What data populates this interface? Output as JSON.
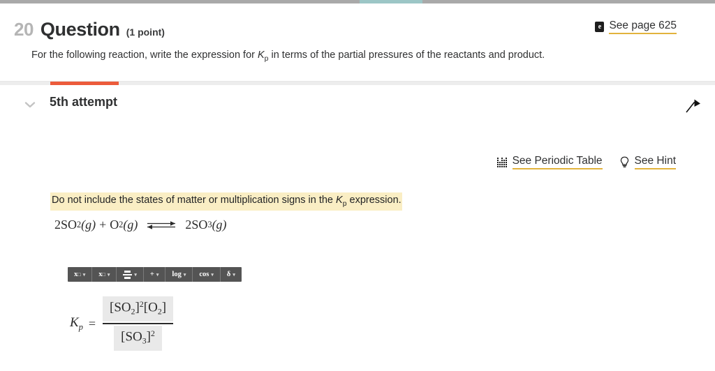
{
  "progress": {
    "completed_segment_label": "current-question-segment",
    "track_color": "#a9a9a9",
    "segment_color": "#9cc6c6"
  },
  "question": {
    "number": "20",
    "title": "Question",
    "points": "(1 point)",
    "prompt_part1": "For the following reaction, write the expression for ",
    "prompt_k": "K",
    "prompt_k_sub": "p",
    "prompt_part2": " in terms of the partial pressures of the reactants and product."
  },
  "ebook": {
    "icon_glyph": "e",
    "label": "See page 625"
  },
  "attempt": {
    "label": "5th attempt",
    "tab_indicator_color": "#ec5b3b",
    "chevron_icon": "chevron-down-icon",
    "flag_icon": "flag-icon"
  },
  "helpers": [
    {
      "icon": "periodic-table-icon",
      "label": "See Periodic Table"
    },
    {
      "icon": "lightbulb-icon",
      "label": "See Hint"
    }
  ],
  "instruction": {
    "part1": "Do not include the states of matter or multiplication signs in the ",
    "k": "K",
    "k_sub": "p",
    "part2": " expression.",
    "highlight_color": "#faeec4"
  },
  "equation": {
    "coeff1": "2",
    "species1": "SO",
    "species1_sub": "2",
    "state1": "(g)",
    "plus": "+",
    "species2": "O",
    "species2_sub": "2",
    "state2": "(g)",
    "arrow": "equilibrium-arrow",
    "coeff2": "2",
    "species3": "SO",
    "species3_sub": "3",
    "state3": "(g)"
  },
  "math_toolbar": {
    "buttons": [
      {
        "name": "superscript",
        "base": "x",
        "sup": "□",
        "sub": "",
        "caret": "▾"
      },
      {
        "name": "subscript",
        "base": "x",
        "sup": "",
        "sub": "□",
        "caret": "▾"
      },
      {
        "name": "fraction",
        "base": "",
        "sup": "",
        "sub": "",
        "caret": "▾"
      },
      {
        "name": "plus",
        "base": "+",
        "sup": "",
        "sub": "",
        "caret": "▾"
      },
      {
        "name": "log",
        "base": "log",
        "sup": "",
        "sub": "",
        "caret": "▾"
      },
      {
        "name": "cos",
        "base": "cos",
        "sup": "",
        "sub": "",
        "caret": "▾"
      },
      {
        "name": "greek-delta",
        "base": "δ",
        "sup": "",
        "sub": "",
        "caret": "▾"
      }
    ]
  },
  "answer": {
    "kp_base": "K",
    "kp_sub": "p",
    "equals": "=",
    "numerator": {
      "term1_open": "[",
      "term1_species": "SO",
      "term1_sub": "2",
      "term1_close": "]",
      "term1_sup": "2",
      "term2_open": "[",
      "term2_species": "O",
      "term2_sub": "2",
      "term2_close": "]"
    },
    "denominator": {
      "open": "[",
      "species": "SO",
      "sub": "3",
      "close": "]",
      "sup": "2"
    },
    "field_bg": "#e9e9e9"
  }
}
